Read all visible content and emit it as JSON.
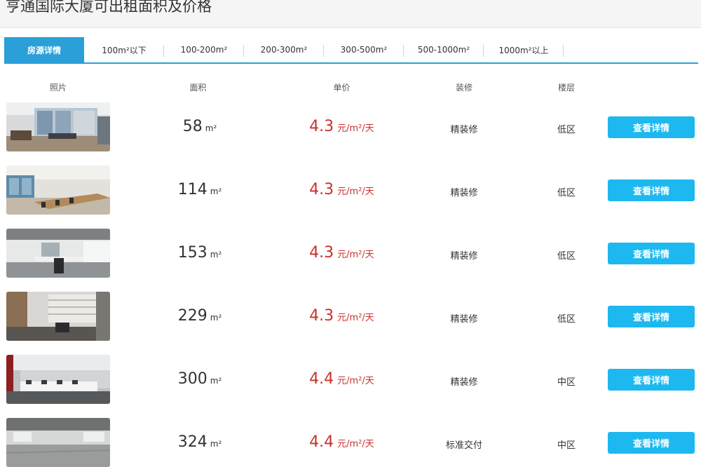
{
  "header": {
    "title": "亨通国际大厦可出租面积及价格"
  },
  "tabs": [
    {
      "label": "房源详情",
      "active": true
    },
    {
      "label": "100m²以下"
    },
    {
      "label": "100-200m²"
    },
    {
      "label": "200-300m²"
    },
    {
      "label": "300-500m²"
    },
    {
      "label": "500-1000m²"
    },
    {
      "label": "1000m²以上"
    }
  ],
  "columns": {
    "photo": "照片",
    "area": "面积",
    "price": "单价",
    "decor": "装修",
    "floor": "楼层"
  },
  "area_unit": "m²",
  "price_unit": "元/m²/天",
  "detail_label": "查看详情",
  "accent_colors": {
    "tab_active": "#2a9fd8",
    "button": "#1db8ef",
    "price": "#c9302c"
  },
  "listings": [
    {
      "area": "58",
      "price": "4.3",
      "decor": "精装修",
      "floor": "低区"
    },
    {
      "area": "114",
      "price": "4.3",
      "decor": "精装修",
      "floor": "低区"
    },
    {
      "area": "153",
      "price": "4.3",
      "decor": "精装修",
      "floor": "低区"
    },
    {
      "area": "229",
      "price": "4.3",
      "decor": "精装修",
      "floor": "低区"
    },
    {
      "area": "300",
      "price": "4.4",
      "decor": "精装修",
      "floor": "中区"
    },
    {
      "area": "324",
      "price": "4.4",
      "decor": "标准交付",
      "floor": "中区"
    }
  ]
}
